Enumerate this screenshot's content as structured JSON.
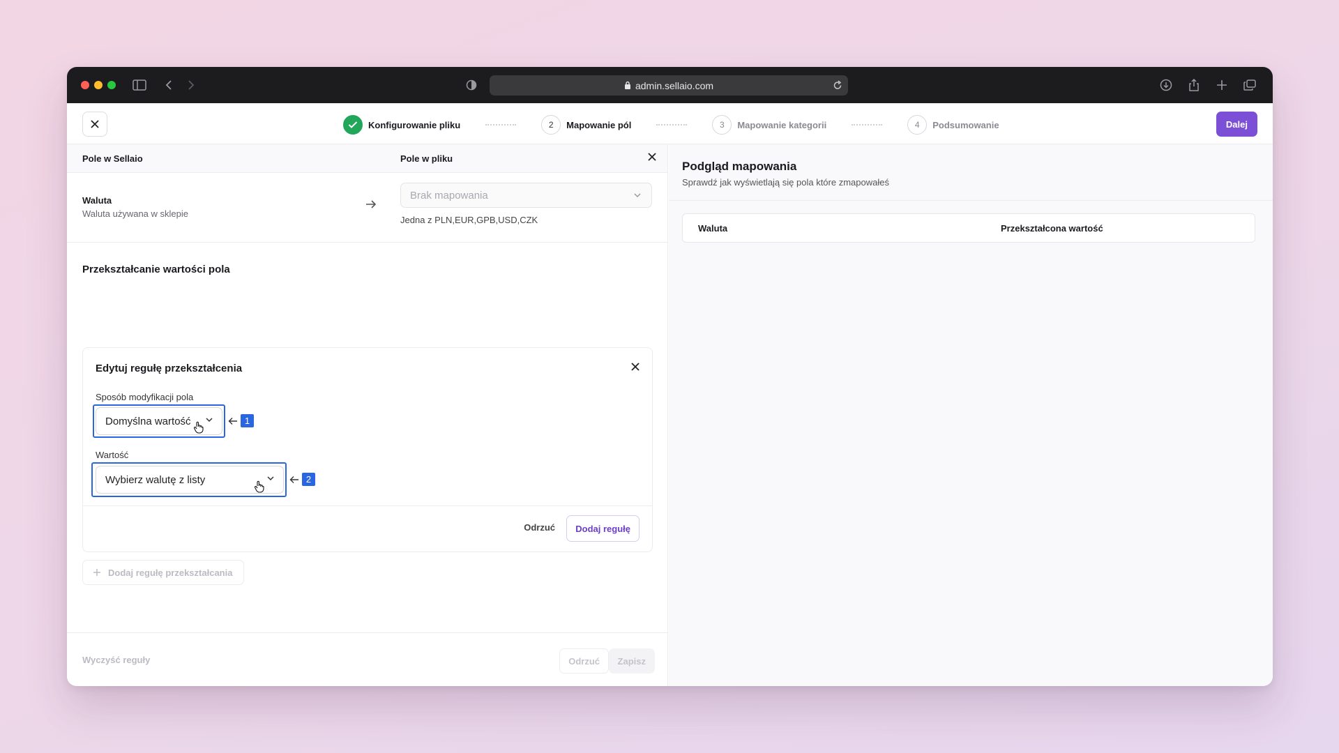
{
  "browser": {
    "url": "admin.sellaio.com",
    "traffic_colors": {
      "close": "#ff5f57",
      "minimize": "#febc2e",
      "zoom": "#28c840"
    }
  },
  "wizard": {
    "steps": [
      {
        "number": "1",
        "label": "Konfigurowanie pliku",
        "state": "done"
      },
      {
        "number": "2",
        "label": "Mapowanie pól",
        "state": "active"
      },
      {
        "number": "3",
        "label": "Mapowanie kategorii",
        "state": "pending"
      },
      {
        "number": "4",
        "label": "Podsumowanie",
        "state": "pending"
      }
    ],
    "next_label": "Dalej",
    "accent": "#7b4fd6"
  },
  "mapping": {
    "col_sellaio": "Pole w Sellaio",
    "col_file": "Pole w pliku",
    "field_title": "Waluta",
    "field_desc": "Waluta używana w sklepie",
    "select_placeholder": "Brak mapowania",
    "select_hint": "Jedna z PLN,EUR,GPB,USD,CZK"
  },
  "transform": {
    "section_title": "Przekształcanie wartości pola",
    "card_title": "Edytuj regułę przekształcenia",
    "method_label": "Sposób modyfikacji pola",
    "method_value": "Domyślna wartość",
    "value_label": "Wartość",
    "value_placeholder": "Wybierz walutę z listy",
    "discard_label": "Odrzuć",
    "add_rule_label": "Dodaj regułę",
    "add_transform_label": "Dodaj regułę przekształcania",
    "annotations": [
      "1",
      "2"
    ]
  },
  "footer": {
    "clear_label": "Wyczyść reguły",
    "discard_label": "Odrzuć",
    "save_label": "Zapisz"
  },
  "preview": {
    "title": "Podgląd mapowania",
    "subtitle": "Sprawdź jak wyświetlają się pola które zmapowałeś",
    "columns": [
      "Waluta",
      "Przekształcona wartość"
    ]
  }
}
